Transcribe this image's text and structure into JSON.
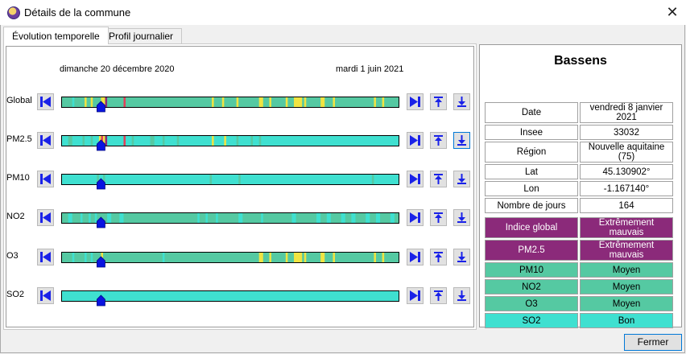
{
  "window": {
    "title": "Détails de la commune",
    "close_icon": "close-icon"
  },
  "tabs": [
    {
      "label": "Évolution temporelle",
      "active": true
    },
    {
      "label": "Profil journalier",
      "active": false
    }
  ],
  "timeline": {
    "start_date": "dimanche 20 décembre 2020",
    "end_date": "mardi 1 juin 2021",
    "days": 164,
    "cursor_day": 19,
    "rows": [
      {
        "label": "Global",
        "base": "#55c9a2",
        "bands": [
          [
            5,
            6,
            "#3fe0d0"
          ],
          [
            11,
            12,
            "#f0e442"
          ],
          [
            14,
            15,
            "#f0e442"
          ],
          [
            19,
            21,
            "#f0e442"
          ],
          [
            21,
            22,
            "#8b2a7a"
          ],
          [
            30,
            31,
            "#e0405a"
          ],
          [
            73,
            74,
            "#f0e442"
          ],
          [
            78,
            79,
            "#f0e442"
          ],
          [
            85,
            86,
            "#f0e442"
          ],
          [
            96,
            98,
            "#f0e442"
          ],
          [
            101,
            102,
            "#f0e442"
          ],
          [
            109,
            110,
            "#f0e442"
          ],
          [
            113,
            117,
            "#f0e442"
          ],
          [
            118,
            119,
            "#f0e442"
          ],
          [
            126,
            128,
            "#f0e442"
          ],
          [
            132,
            133,
            "#f0e442"
          ],
          [
            152,
            153,
            "#f0e442"
          ],
          [
            156,
            157,
            "#f0e442"
          ]
        ]
      },
      {
        "label": "PM2.5",
        "base": "#3fe0d0",
        "bands": [
          [
            3,
            5,
            "#55c9a2"
          ],
          [
            10,
            11,
            "#55c9a2"
          ],
          [
            14,
            15,
            "#55c9a2"
          ],
          [
            18,
            19,
            "#f0e442"
          ],
          [
            19,
            20,
            "#e0405a"
          ],
          [
            20,
            21,
            "#f0e442"
          ],
          [
            21,
            22,
            "#8b2a7a"
          ],
          [
            30,
            31,
            "#e0405a"
          ],
          [
            34,
            35,
            "#55c9a2"
          ],
          [
            43,
            45,
            "#55c9a2"
          ],
          [
            49,
            50,
            "#55c9a2"
          ],
          [
            56,
            57,
            "#55c9a2"
          ],
          [
            73,
            74,
            "#f0e442"
          ],
          [
            79,
            80,
            "#f0e442"
          ],
          [
            85,
            86,
            "#55c9a2"
          ],
          [
            92,
            93,
            "#55c9a2"
          ],
          [
            96,
            97,
            "#55c9a2"
          ]
        ]
      },
      {
        "label": "PM10",
        "base": "#3fe0d0",
        "bands": [
          [
            17,
            18,
            "#55c9a2"
          ],
          [
            20,
            21,
            "#55c9a2"
          ],
          [
            72,
            73,
            "#55c9a2"
          ],
          [
            86,
            87,
            "#55c9a2"
          ],
          [
            151,
            152,
            "#55c9a2"
          ]
        ]
      },
      {
        "label": "NO2",
        "base": "#55c9a2",
        "bands": [
          [
            3,
            5,
            "#3fe0d0"
          ],
          [
            9,
            10,
            "#3fe0d0"
          ],
          [
            13,
            14,
            "#3fe0d0"
          ],
          [
            16,
            17,
            "#3fe0d0"
          ],
          [
            22,
            24,
            "#3fe0d0"
          ],
          [
            28,
            30,
            "#3fe0d0"
          ],
          [
            66,
            67,
            "#3fe0d0"
          ],
          [
            70,
            71,
            "#3fe0d0"
          ],
          [
            75,
            76,
            "#3fe0d0"
          ],
          [
            86,
            88,
            "#3fe0d0"
          ],
          [
            97,
            98,
            "#3fe0d0"
          ],
          [
            112,
            114,
            "#3fe0d0"
          ],
          [
            124,
            126,
            "#3fe0d0"
          ],
          [
            129,
            131,
            "#3fe0d0"
          ],
          [
            136,
            138,
            "#3fe0d0"
          ],
          [
            141,
            143,
            "#3fe0d0"
          ],
          [
            148,
            150,
            "#3fe0d0"
          ],
          [
            153,
            155,
            "#3fe0d0"
          ],
          [
            160,
            162,
            "#3fe0d0"
          ]
        ]
      },
      {
        "label": "O3",
        "base": "#55c9a2",
        "bands": [
          [
            5,
            6,
            "#3fe0d0"
          ],
          [
            11,
            12,
            "#3fe0d0"
          ],
          [
            14,
            15,
            "#3fe0d0"
          ],
          [
            19,
            20,
            "#f0e442"
          ],
          [
            49,
            50,
            "#3fe0d0"
          ],
          [
            96,
            98,
            "#f0e442"
          ],
          [
            101,
            102,
            "#f0e442"
          ],
          [
            109,
            110,
            "#f0e442"
          ],
          [
            113,
            117,
            "#f0e442"
          ],
          [
            118,
            119,
            "#f0e442"
          ],
          [
            126,
            128,
            "#f0e442"
          ],
          [
            132,
            133,
            "#f0e442"
          ],
          [
            152,
            153,
            "#f0e442"
          ],
          [
            156,
            157,
            "#f0e442"
          ]
        ]
      },
      {
        "label": "SO2",
        "base": "#3fe0d0",
        "bands": []
      }
    ],
    "buttons": {
      "first_icon": "skip-first-icon",
      "last_icon": "skip-last-icon",
      "up_icon": "move-up-icon",
      "down_icon": "move-down-icon"
    }
  },
  "details": {
    "name": "Bassens",
    "info": [
      {
        "key": "Date",
        "value": "vendredi 8 janvier 2021"
      },
      {
        "key": "Insee",
        "value": "33032"
      },
      {
        "key": "Région",
        "value": "Nouvelle aquitaine (75)"
      },
      {
        "key": "Lat",
        "value": "45.130902°"
      },
      {
        "key": "Lon",
        "value": "-1.167140°"
      },
      {
        "key": "Nombre de jours",
        "value": "164"
      }
    ],
    "indices": [
      {
        "key": "Indice global",
        "value": "Extrêmement mauvais",
        "color": "#8b2a7a"
      },
      {
        "key": "PM2.5",
        "value": "Extrêmement mauvais",
        "color": "#8b2a7a"
      },
      {
        "key": "PM10",
        "value": "Moyen",
        "color": "#55c9a2"
      },
      {
        "key": "NO2",
        "value": "Moyen",
        "color": "#55c9a2"
      },
      {
        "key": "O3",
        "value": "Moyen",
        "color": "#55c9a2"
      },
      {
        "key": "SO2",
        "value": "Bon",
        "color": "#3fe0d0"
      }
    ]
  },
  "footer": {
    "close_label": "Fermer"
  }
}
